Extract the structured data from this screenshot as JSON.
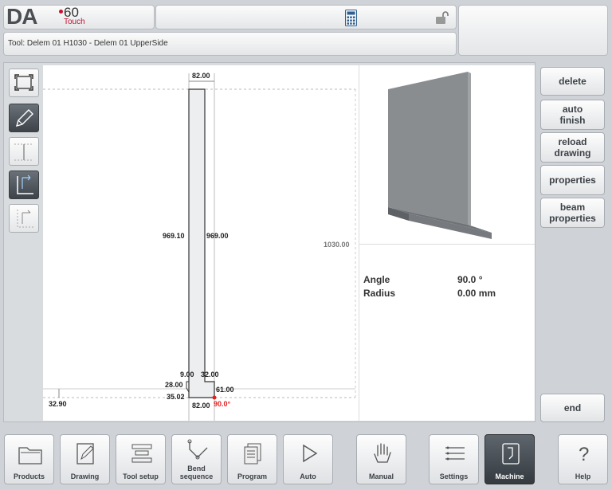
{
  "header": {
    "logo_text": "DA",
    "logo_model": "60",
    "logo_sub": "Touch",
    "tool_label": "Tool: Delem 01 H1030 - Delem 01 UpperSide",
    "calculator_icon": "calculator-icon",
    "lock_icon": "unlock-icon"
  },
  "drawing": {
    "dims": {
      "top_width": "82.00",
      "left_height": "969.10",
      "right_height": "969.00",
      "total_height": "1030.00",
      "d_9": "9.00",
      "d_32": "32.00",
      "d_28": "28.00",
      "d_61": "61.00",
      "d_35": "35.02",
      "d_bottom": "82.00",
      "angle": "90.0°",
      "offset": "32.90"
    }
  },
  "info": {
    "angle_label": "Angle",
    "angle_value": "90.0 °",
    "radius_label": "Radius",
    "radius_value": "0.00 mm"
  },
  "right_buttons": {
    "delete": "delete",
    "auto_finish": "auto\nfinish",
    "reload_drawing": "reload\ndrawing",
    "properties": "properties",
    "beam_properties": "beam\nproperties",
    "end": "end"
  },
  "bottom_nav": {
    "products": "Products",
    "drawing": "Drawing",
    "tool_setup": "Tool setup",
    "bend_sequence": "Bend\nsequence",
    "program": "Program",
    "auto": "Auto",
    "manual": "Manual",
    "settings": "Settings",
    "machine": "Machine",
    "help": "Help"
  },
  "colors": {
    "accent_red": "#c8102e",
    "dark_button": "#3d4349",
    "background": "#cfd3d8"
  }
}
